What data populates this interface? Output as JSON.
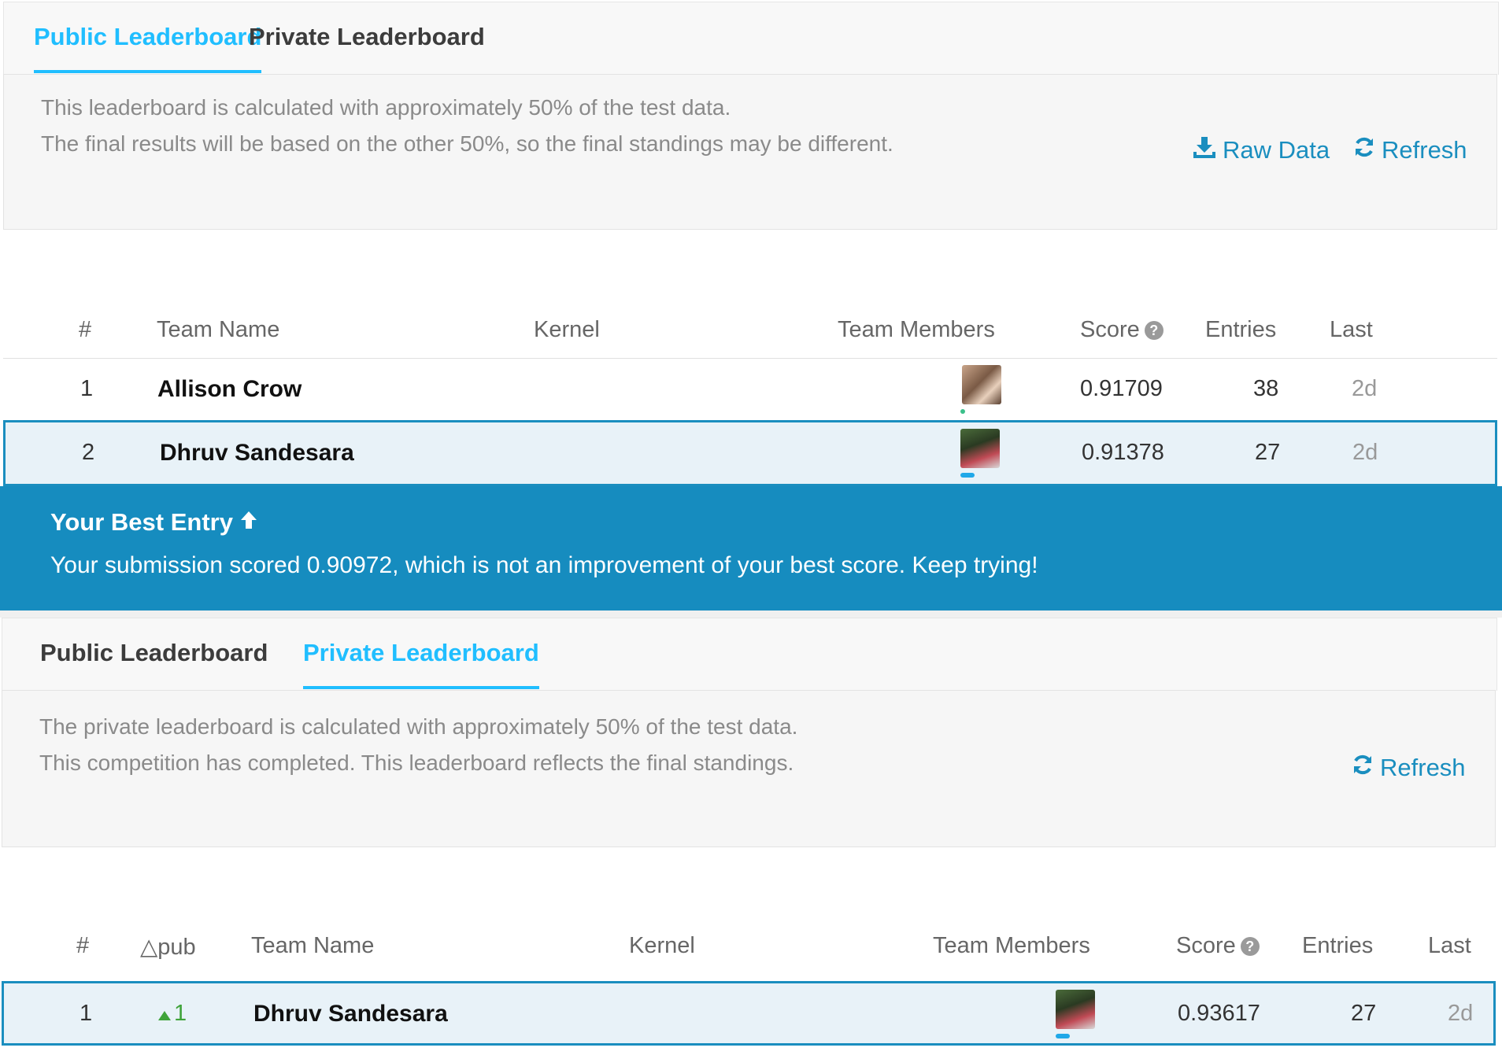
{
  "public_panel": {
    "tabs": [
      {
        "label": "Public Leaderboard",
        "active": true
      },
      {
        "label": "Private Leaderboard",
        "active": false
      }
    ],
    "info_lines": [
      "This leaderboard is calculated with approximately 50% of the test data.",
      "The final results will be based on the other 50%, so the final standings may be different."
    ],
    "actions": {
      "raw_data": "Raw Data",
      "refresh": "Refresh"
    },
    "columns": {
      "rank": "#",
      "team_name": "Team Name",
      "kernel": "Kernel",
      "team_members": "Team Members",
      "score": "Score",
      "entries": "Entries",
      "last": "Last"
    },
    "rows": [
      {
        "rank": "1",
        "team_name": "Allison Crow",
        "score": "0.91709",
        "entries": "38",
        "last": "2d",
        "highlight": false
      },
      {
        "rank": "2",
        "team_name": "Dhruv Sandesara",
        "score": "0.91378",
        "entries": "27",
        "last": "2d",
        "highlight": true
      }
    ]
  },
  "best_entry": {
    "title": "Your Best Entry",
    "message": "Your submission scored 0.90972, which is not an improvement of your best score. Keep trying!"
  },
  "private_panel": {
    "tabs": [
      {
        "label": "Public Leaderboard",
        "active": false
      },
      {
        "label": "Private Leaderboard",
        "active": true
      }
    ],
    "info_lines": [
      "The private leaderboard is calculated with approximately 50% of the test data.",
      "This competition has completed. This leaderboard reflects the final standings."
    ],
    "actions": {
      "refresh": "Refresh"
    },
    "columns": {
      "rank": "#",
      "delta_pub": "△pub",
      "team_name": "Team Name",
      "kernel": "Kernel",
      "team_members": "Team Members",
      "score": "Score",
      "entries": "Entries",
      "last": "Last"
    },
    "rows": [
      {
        "rank": "1",
        "delta": "1",
        "team_name": "Dhruv Sandesara",
        "score": "0.93617",
        "entries": "27",
        "last": "2d",
        "highlight": true
      }
    ]
  },
  "colors": {
    "accent": "#20beff",
    "link": "#1a8ebf",
    "banner": "#168cbf",
    "up": "#3fa33a"
  },
  "icons": [
    "download-icon",
    "refresh-icon",
    "help-icon",
    "arrow-up-icon",
    "triangle-up-icon"
  ]
}
